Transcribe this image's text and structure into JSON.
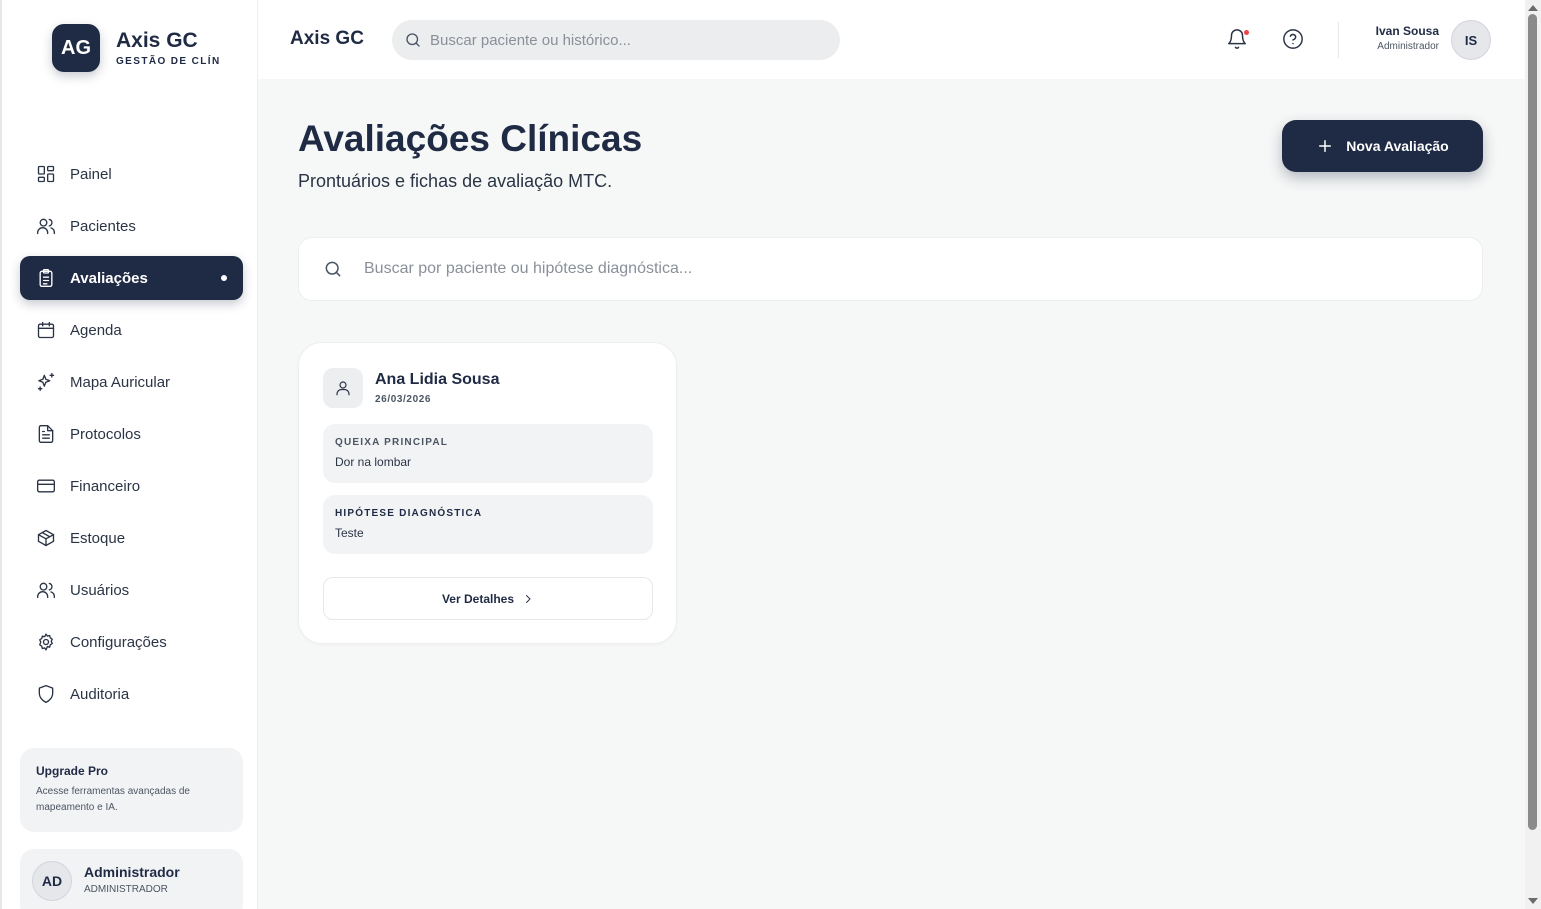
{
  "brand": {
    "initials": "AG",
    "name": "Axis GC",
    "subtitle": "GESTÃO DE CLÍN"
  },
  "sidebar": {
    "items": [
      {
        "label": "Painel",
        "icon": "layout-grid-icon"
      },
      {
        "label": "Pacientes",
        "icon": "users-icon"
      },
      {
        "label": "Avaliações",
        "icon": "clipboard-icon",
        "active": true
      },
      {
        "label": "Agenda",
        "icon": "calendar-icon"
      },
      {
        "label": "Mapa Auricular",
        "icon": "sparkles-icon"
      },
      {
        "label": "Protocolos",
        "icon": "file-text-icon"
      },
      {
        "label": "Financeiro",
        "icon": "credit-card-icon"
      },
      {
        "label": "Estoque",
        "icon": "package-icon"
      },
      {
        "label": "Usuários",
        "icon": "users-icon"
      },
      {
        "label": "Configurações",
        "icon": "gear-icon"
      },
      {
        "label": "Auditoria",
        "icon": "shield-icon"
      }
    ],
    "upgrade": {
      "title": "Upgrade Pro",
      "description": "Acesse ferramentas avançadas de mapeamento e IA."
    },
    "user": {
      "initials": "AD",
      "name": "Administrador",
      "role": "ADMINISTRADOR"
    }
  },
  "header": {
    "title": "Axis GC",
    "search_placeholder": "Buscar paciente ou histórico...",
    "user": {
      "name": "Ivan Sousa",
      "role": "Administrador",
      "initials": "IS"
    }
  },
  "main": {
    "title": "Avaliações Clínicas",
    "subtitle": "Prontuários e fichas de avaliação MTC.",
    "new_button": "Nova Avaliação",
    "search_placeholder": "Buscar por paciente ou hipótese diagnóstica...",
    "cards": [
      {
        "patient": "Ana Lidia Sousa",
        "date": "26/03/2026",
        "complaint_label": "QUEIXA PRINCIPAL",
        "complaint": "Dor na lombar",
        "hypothesis_label": "HIPÓTESE DIAGNÓSTICA",
        "hypothesis": "Teste",
        "details_button": "Ver Detalhes"
      }
    ]
  },
  "colors": {
    "primary": "#1f2a44",
    "background": "#f6f7f7",
    "notification": "#ef4444"
  }
}
